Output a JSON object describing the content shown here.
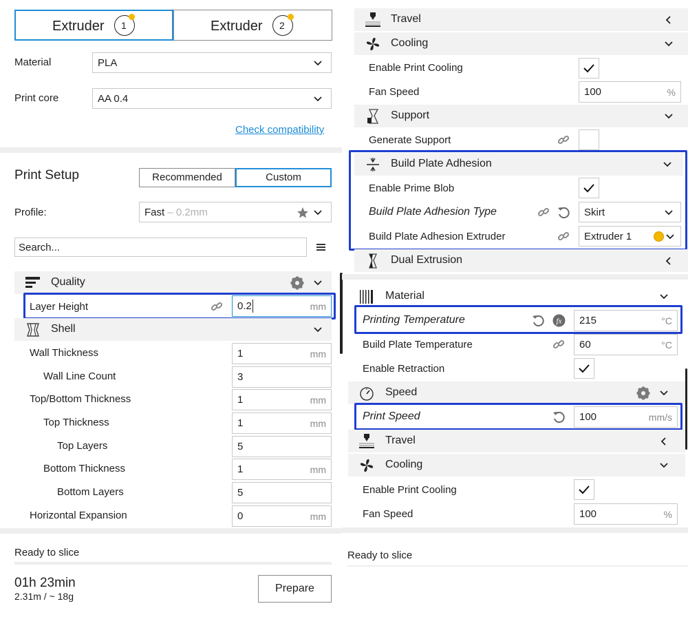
{
  "left": {
    "extruder_tabs": [
      {
        "label": "Extruder",
        "number": "1"
      },
      {
        "label": "Extruder",
        "number": "2"
      }
    ],
    "material_label": "Material",
    "material_value": "PLA",
    "print_core_label": "Print core",
    "print_core_value": "AA 0.4",
    "check_compat": "Check compatibility",
    "print_setup_title": "Print Setup",
    "mode_recommended": "Recommended",
    "mode_custom": "Custom",
    "profile_label": "Profile:",
    "profile_value": "Fast",
    "profile_suffix": " – 0.2mm",
    "search_placeholder": "Search...",
    "quality_title": "Quality",
    "layer_height_label": "Layer Height",
    "layer_height_value": "0.2",
    "shell_title": "Shell",
    "shell_settings": [
      {
        "label": "Wall Thickness",
        "value": "1",
        "unit": "mm"
      },
      {
        "label": "Wall Line Count",
        "value": "3",
        "unit": ""
      },
      {
        "label": "Top/Bottom Thickness",
        "value": "1",
        "unit": "mm"
      },
      {
        "label": "Top Thickness",
        "value": "1",
        "unit": "mm"
      },
      {
        "label": "Top Layers",
        "value": "5",
        "unit": ""
      },
      {
        "label": "Bottom Thickness",
        "value": "1",
        "unit": "mm"
      },
      {
        "label": "Bottom Layers",
        "value": "5",
        "unit": ""
      },
      {
        "label": "Horizontal Expansion",
        "value": "0",
        "unit": "mm"
      }
    ],
    "ready_text": "Ready to slice",
    "time": "01h 23min",
    "material_usage": "2.31m / ~ 18g",
    "prepare_label": "Prepare"
  },
  "right_top": {
    "travel_title": "Travel",
    "cooling_title": "Cooling",
    "enable_cooling_label": "Enable Print Cooling",
    "fan_speed_label": "Fan Speed",
    "fan_speed_value": "100",
    "support_title": "Support",
    "generate_support_label": "Generate Support",
    "adhesion_title": "Build Plate Adhesion",
    "prime_blob_label": "Enable Prime Blob",
    "adhesion_type_label": "Build Plate Adhesion Type",
    "adhesion_type_value": "Skirt",
    "adhesion_extruder_label": "Build Plate Adhesion Extruder",
    "adhesion_extruder_value": "Extruder 1",
    "dual_title": "Dual Extrusion"
  },
  "right_bottom": {
    "material_title": "Material",
    "print_temp_label": "Printing Temperature",
    "print_temp_value": "215",
    "bed_temp_label": "Build Plate Temperature",
    "bed_temp_value": "60",
    "retraction_label": "Enable Retraction",
    "speed_title": "Speed",
    "print_speed_label": "Print Speed",
    "print_speed_value": "100",
    "travel_title": "Travel",
    "cooling_title": "Cooling",
    "enable_cooling_label": "Enable Print Cooling",
    "fan_speed_label": "Fan Speed",
    "fan_speed_value": "100",
    "ready_text": "Ready to slice"
  },
  "units": {
    "mm": "mm",
    "percent": "%",
    "celsius": "°C",
    "mms": "mm/s"
  },
  "colors": {
    "accent": "#1f8fd6",
    "highlight": "#1f3fd0",
    "extruder_dot": "#f5b800",
    "link": "#1a8bd8"
  }
}
